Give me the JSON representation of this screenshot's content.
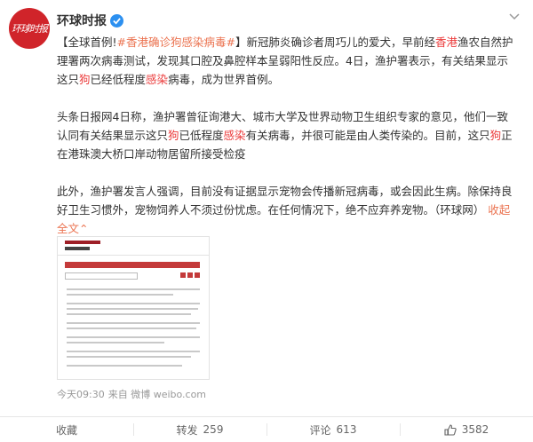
{
  "account": {
    "avatar_text": "环球时报",
    "name": "环球时报"
  },
  "post": {
    "p1": [
      {
        "t": "【全球首例!",
        "c": ""
      },
      {
        "t": "#香港确诊狗感染病毒#",
        "c": "tag"
      },
      {
        "t": "】新冠肺炎确诊者周巧儿的爱犬，早前经",
        "c": ""
      },
      {
        "t": "香港",
        "c": "kw"
      },
      {
        "t": "渔农自然护理署两次病毒测试，发现其口腔及鼻腔样本呈弱阳性反应。4日，渔护署表示，有关结果显示这只",
        "c": ""
      },
      {
        "t": "狗",
        "c": "kw"
      },
      {
        "t": "已经低程度",
        "c": ""
      },
      {
        "t": "感染",
        "c": "kw"
      },
      {
        "t": "病毒，成为世界首例。",
        "c": ""
      }
    ],
    "p2": [
      {
        "t": "头条日报网4日称，渔护署曾征询港大、城市大学及世界动物卫生组织专家的意见，他们一致认同有关结果显示这只",
        "c": ""
      },
      {
        "t": "狗",
        "c": "kw"
      },
      {
        "t": "已低程度",
        "c": ""
      },
      {
        "t": "感染",
        "c": "kw"
      },
      {
        "t": "有关病毒，并很可能是由人类传染的。目前，这只",
        "c": ""
      },
      {
        "t": "狗",
        "c": "kw"
      },
      {
        "t": "正在港珠澳大桥口岸动物居留所接受检疫",
        "c": ""
      }
    ],
    "p3": [
      {
        "t": "此外，渔护署发言人强调，目前没有证据显示宠物会传播新冠病毒，或会因此生病。除保持良好卫生习惯外，宠物饲养人不须过份忧虑。在任何情况下，绝不应弃养宠物。（环球网） ",
        "c": ""
      },
      {
        "t": "收起全文",
        "c": "link"
      },
      {
        "t": "⌃",
        "c": "link"
      }
    ]
  },
  "meta": {
    "time": "今天09:30",
    "source": "来自 微博 weibo.com"
  },
  "footer": {
    "collect": "收藏",
    "repost_label": "转发",
    "repost_count": "259",
    "comment_label": "评论",
    "comment_count": "613",
    "like_count": "3582"
  },
  "colors": {
    "accent": "#eb7350",
    "keyword": "#eb3b3b",
    "brand_red": "#d0242a",
    "verified_blue": "#2c90f0"
  },
  "icons": [
    "verified-badge-icon",
    "chevron-down-icon",
    "comment-icon",
    "like-icon"
  ]
}
